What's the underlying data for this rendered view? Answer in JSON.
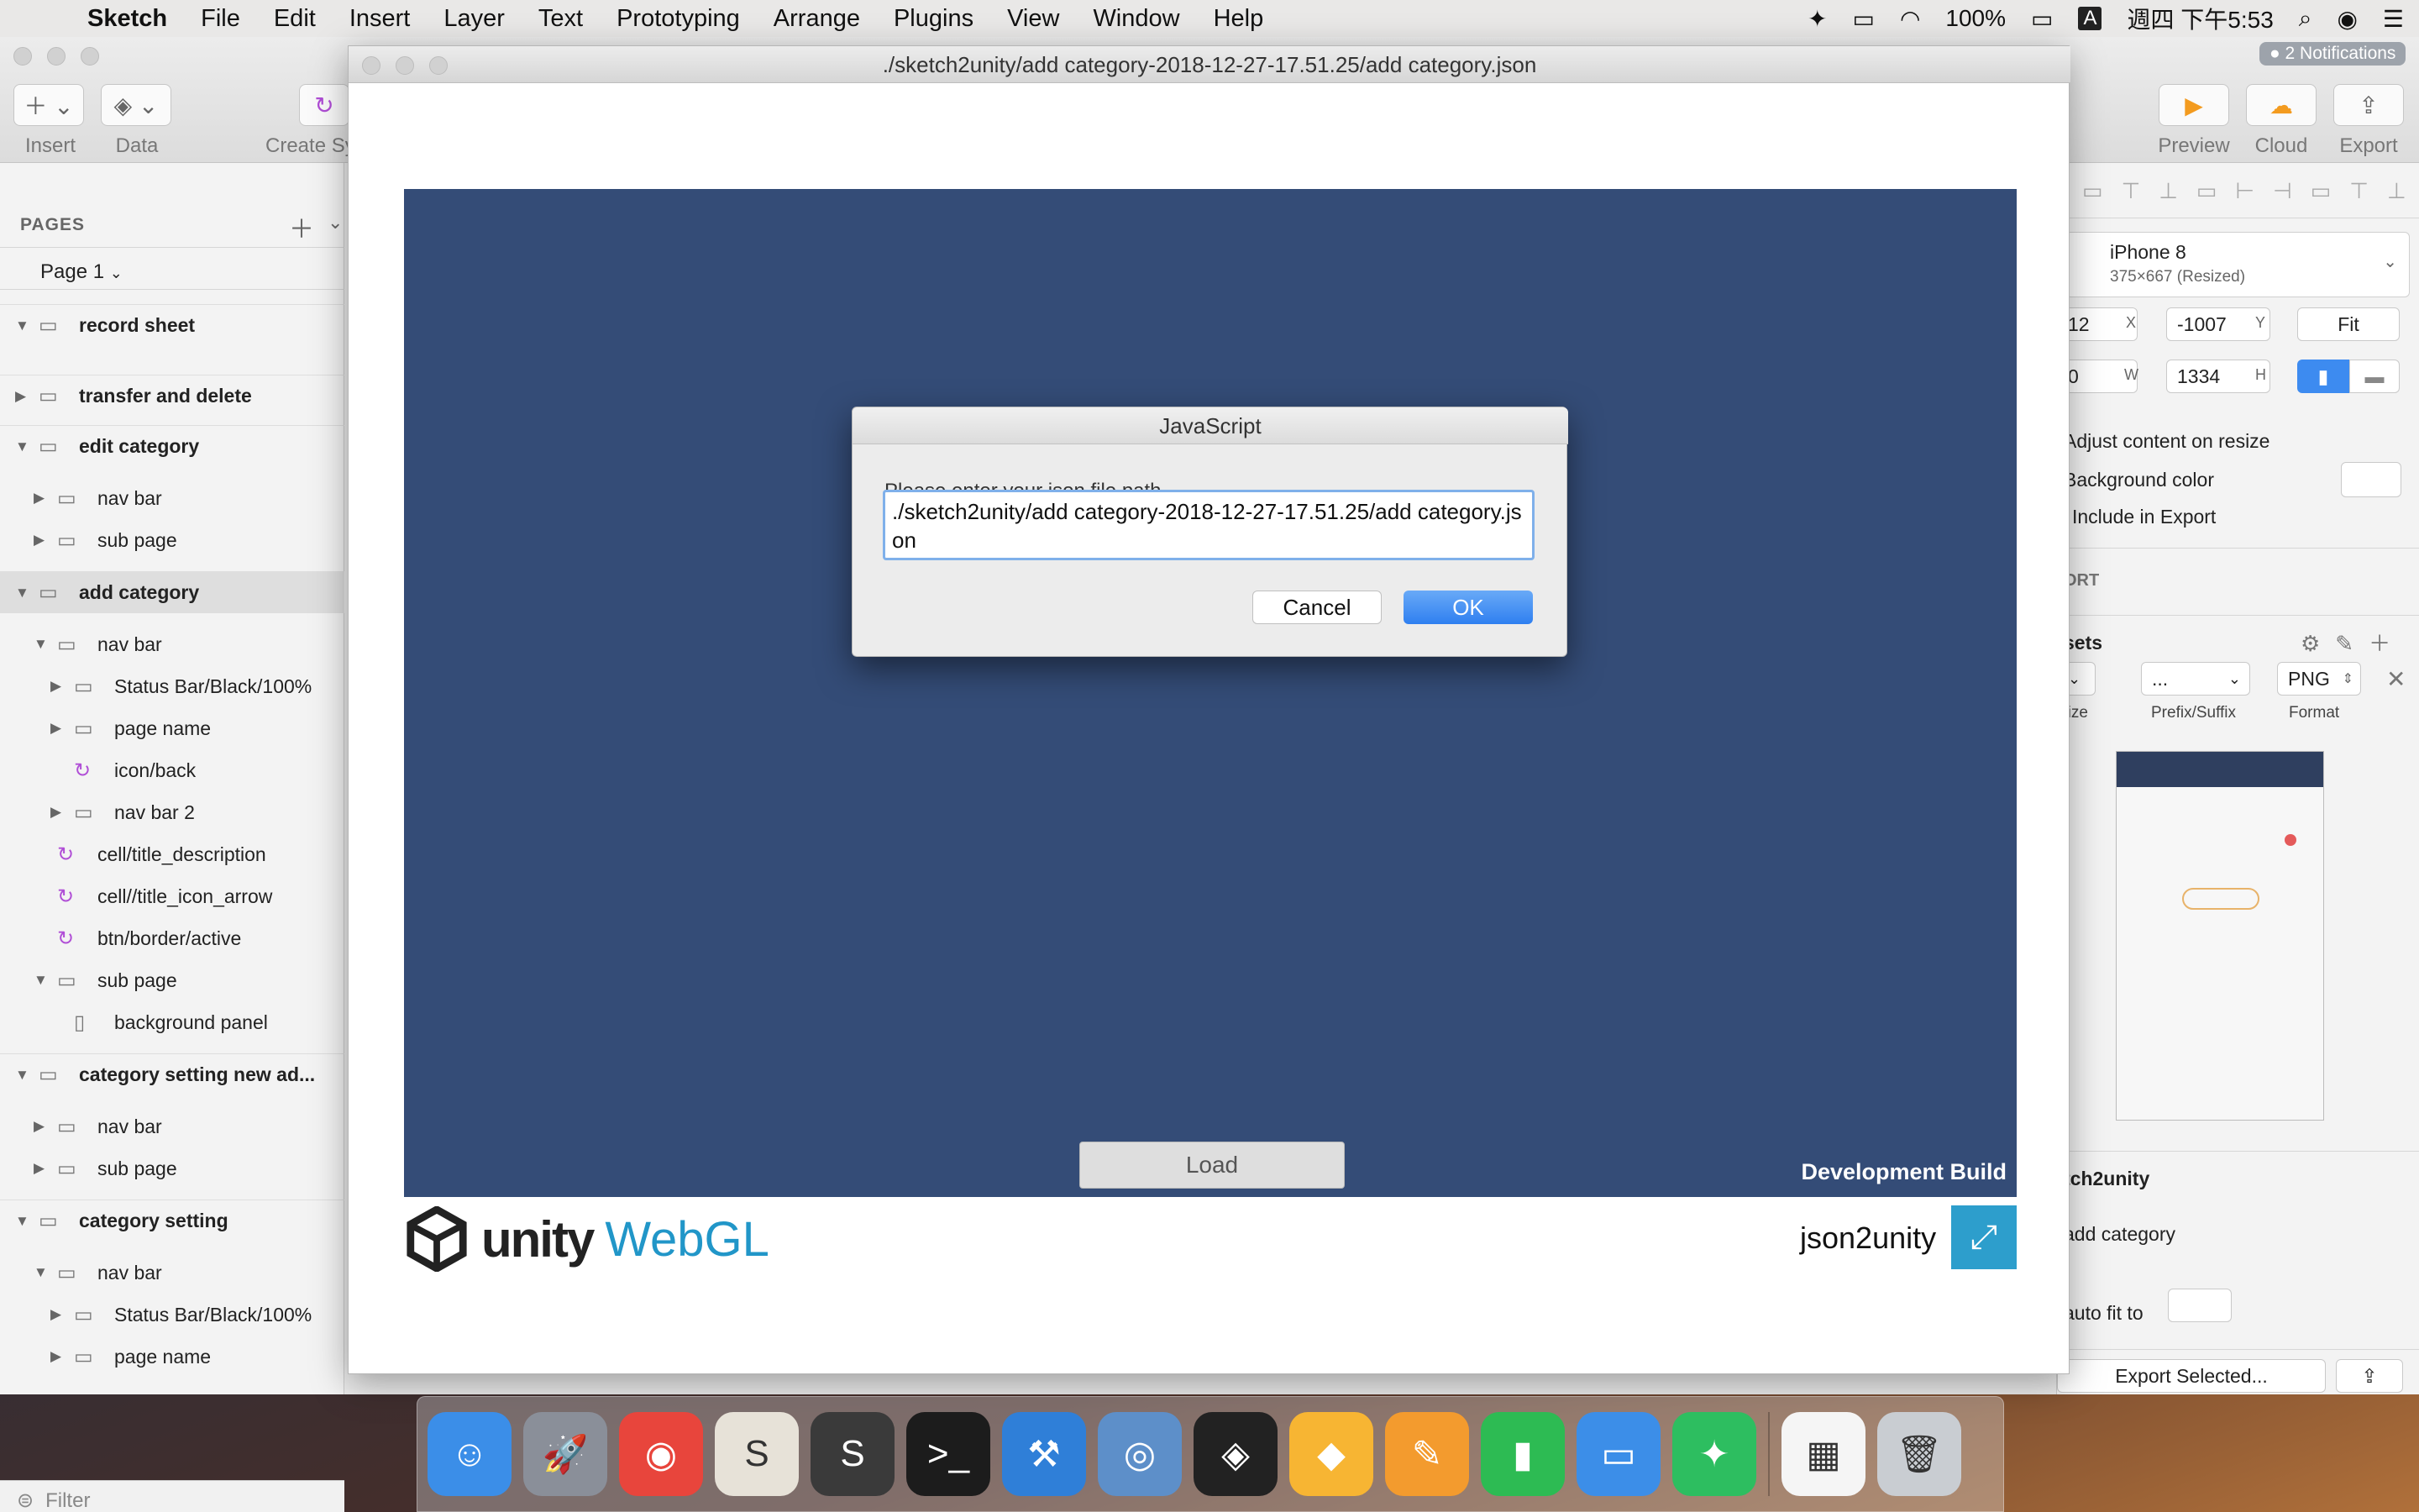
{
  "menubar": {
    "app": "Sketch",
    "items": [
      "File",
      "Edit",
      "Insert",
      "Layer",
      "Text",
      "Prototyping",
      "Arrange",
      "Plugins",
      "View",
      "Window",
      "Help"
    ],
    "battery": "100%",
    "input_method": "A",
    "clock": "週四 下午5:53"
  },
  "notifications": "2 Notifications",
  "toolbar": {
    "insert_label": "Insert",
    "data_label": "Data",
    "create_symbol_label": "Create Sy",
    "preview_label": "Preview",
    "cloud_label": "Cloud",
    "export_label": "Export"
  },
  "pages": {
    "header": "PAGES",
    "current": "Page 1"
  },
  "layers": [
    {
      "label": "record sheet",
      "type": "artboard",
      "expanded": true
    },
    {
      "label": "transfer and delete",
      "type": "artboard",
      "expanded": false
    },
    {
      "label": "edit category",
      "type": "artboard",
      "expanded": true
    },
    {
      "label": "nav bar",
      "type": "group",
      "expanded": false
    },
    {
      "label": "sub page",
      "type": "group",
      "expanded": false
    },
    {
      "label": "add category",
      "type": "artboard",
      "expanded": true,
      "selected": true
    },
    {
      "label": "nav bar",
      "type": "group",
      "expanded": true
    },
    {
      "label": "Status Bar/Black/100%",
      "type": "group",
      "expanded": false
    },
    {
      "label": "page name",
      "type": "group",
      "expanded": false
    },
    {
      "label": "icon/back",
      "type": "symbol"
    },
    {
      "label": "nav bar 2",
      "type": "group",
      "expanded": false
    },
    {
      "label": "cell/title_description",
      "type": "symbol"
    },
    {
      "label": "cell//title_icon_arrow",
      "type": "symbol"
    },
    {
      "label": "btn/border/active",
      "type": "symbol"
    },
    {
      "label": "sub page",
      "type": "group",
      "expanded": true
    },
    {
      "label": "background panel",
      "type": "shape"
    },
    {
      "label": "category setting new ad...",
      "type": "artboard",
      "expanded": true
    },
    {
      "label": "nav bar",
      "type": "group",
      "expanded": false
    },
    {
      "label": "sub page",
      "type": "group",
      "expanded": false
    },
    {
      "label": "category setting",
      "type": "artboard",
      "expanded": true
    },
    {
      "label": "nav bar",
      "type": "group",
      "expanded": true
    },
    {
      "label": "Status Bar/Black/100%",
      "type": "group",
      "expanded": false
    },
    {
      "label": "page name",
      "type": "group",
      "expanded": false
    }
  ],
  "filter_placeholder": "Filter",
  "inspector": {
    "device": "iPhone 8",
    "device_size": "375×667 (Resized)",
    "x_value": "12",
    "x_label": "X",
    "y_value": "-1007",
    "y_label": "Y",
    "fit_label": "Fit",
    "w_value": "0",
    "w_label": "W",
    "h_value": "1334",
    "h_label": "H",
    "adjust_content": "Adjust content on resize",
    "background_color": "Background color",
    "include_export": "Include in Export",
    "export_header": "ORT",
    "presets_label": "sets",
    "size_col": "Size",
    "prefix_col": "Prefix/Suffix",
    "format_col": "Format",
    "prefix_value": "...",
    "format_value": "PNG",
    "plugin_name": "tch2unity",
    "artboard_name": "add category",
    "auto_fit": "auto fit to",
    "export_selected": "Export Selected..."
  },
  "unity_window": {
    "title": "./sketch2unity/add category-2018-12-27-17.51.25/add category.json",
    "load_button": "Load",
    "dev_build": "Development Build",
    "logo_unity": "unity",
    "logo_webgl": "WebGL",
    "app_title": "json2unity"
  },
  "dialog": {
    "title": "JavaScript",
    "prompt": "Please enter your json file path",
    "input_value": "./sketch2unity/add category-2018-12-27-17.51.25/add category.json",
    "cancel_label": "Cancel",
    "ok_label": "OK"
  },
  "dock": [
    {
      "name": "Finder",
      "color": "#3b8ee8",
      "glyph": "☺"
    },
    {
      "name": "Launchpad",
      "color": "#8a8f99",
      "glyph": "🚀"
    },
    {
      "name": "Chrome",
      "color": "#e8453c",
      "glyph": "◉"
    },
    {
      "name": "Slack",
      "color": "#e7e2d8",
      "glyph": "S"
    },
    {
      "name": "Sublime Text",
      "color": "#3a3a3a",
      "glyph": "S"
    },
    {
      "name": "Terminal",
      "color": "#1c1c1c",
      "glyph": ">_"
    },
    {
      "name": "Xcode",
      "color": "#2f7fd8",
      "glyph": "⚒"
    },
    {
      "name": "Proxyman",
      "color": "#5d8fc9",
      "glyph": "◎"
    },
    {
      "name": "Unity",
      "color": "#222222",
      "glyph": "◈"
    },
    {
      "name": "Sketch",
      "color": "#f7b533",
      "glyph": "◆"
    },
    {
      "name": "Pages",
      "color": "#f39b2e",
      "glyph": "✎"
    },
    {
      "name": "Numbers",
      "color": "#2dbb53",
      "glyph": "▮"
    },
    {
      "name": "Keynote",
      "color": "#3c8ee8",
      "glyph": "▭"
    },
    {
      "name": "Evernote",
      "color": "#2dbe60",
      "glyph": "✦"
    },
    {
      "name": "Document",
      "color": "#f5f5f5",
      "glyph": "▦"
    },
    {
      "name": "Trash",
      "color": "#c9cdd2",
      "glyph": "🗑"
    }
  ]
}
